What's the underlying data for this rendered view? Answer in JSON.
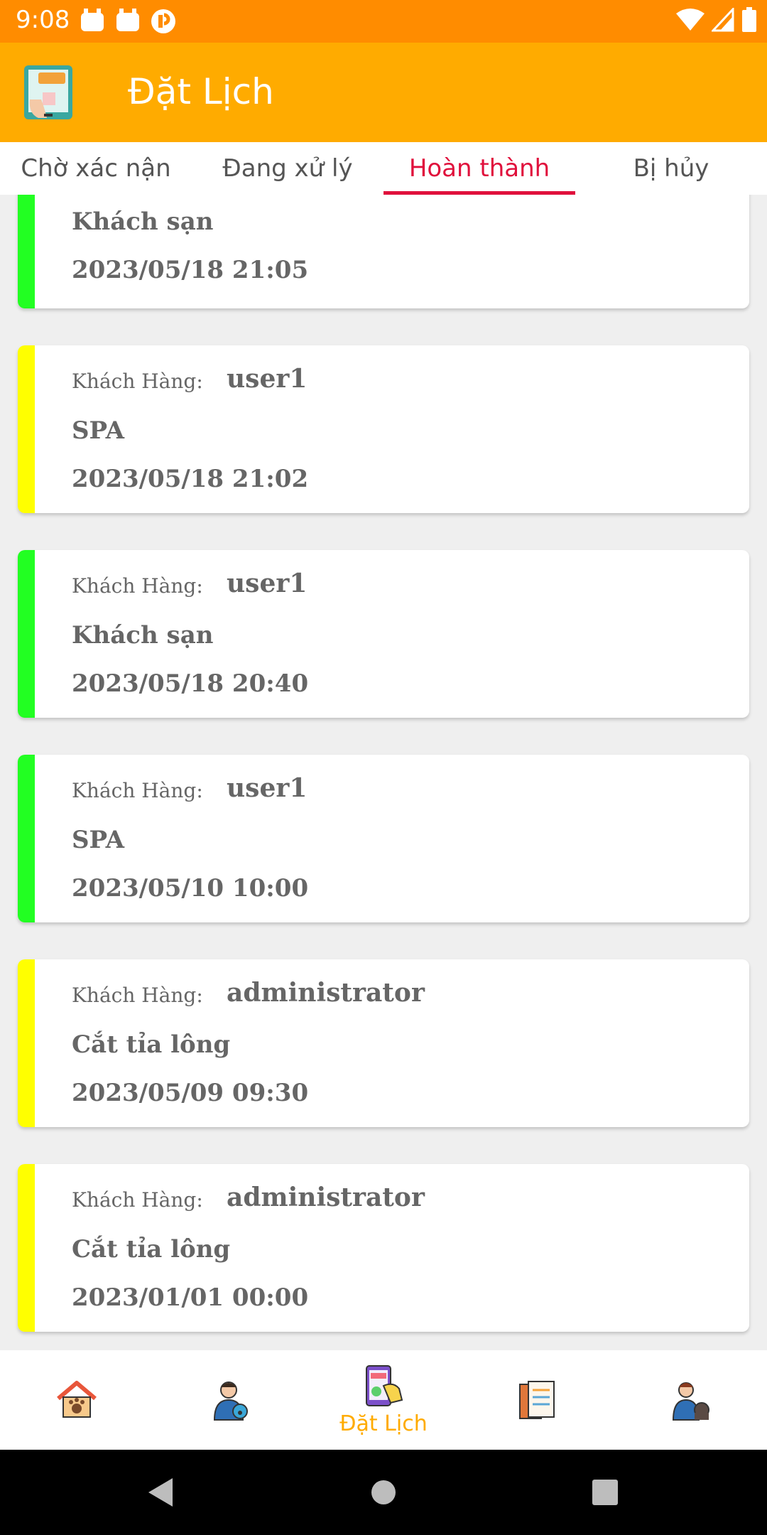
{
  "status_bar": {
    "time": "9:08"
  },
  "app_bar": {
    "title": "Đặt Lịch"
  },
  "tabs": [
    {
      "label": "Chờ xác nận"
    },
    {
      "label": "Đang xử lý"
    },
    {
      "label": "Hoàn thành",
      "active": true
    },
    {
      "label": "Bị hủy"
    }
  ],
  "bookings": [
    {
      "customer_label": "",
      "customer": "",
      "service": "Khách sạn",
      "datetime": "2023/05/18 21:05",
      "status_color": "#22ff22"
    },
    {
      "customer_label": "Khách Hàng:",
      "customer": "user1",
      "service": "SPA",
      "datetime": "2023/05/18 21:02",
      "status_color": "#ffff00"
    },
    {
      "customer_label": "Khách Hàng:",
      "customer": "user1",
      "service": "Khách sạn",
      "datetime": "2023/05/18 20:40",
      "status_color": "#22ff22"
    },
    {
      "customer_label": "Khách Hàng:",
      "customer": "user1",
      "service": "SPA",
      "datetime": "2023/05/10 10:00",
      "status_color": "#22ff22"
    },
    {
      "customer_label": "Khách Hàng:",
      "customer": "administrator",
      "service": "Cắt tỉa lông",
      "datetime": "2023/05/09 09:30",
      "status_color": "#ffff00"
    },
    {
      "customer_label": "Khách Hàng:",
      "customer": "administrator",
      "service": "Cắt tỉa lông",
      "datetime": "2023/01/01 00:00",
      "status_color": "#ffff00"
    }
  ],
  "bottom_nav": {
    "items": [
      {
        "icon": "pet-house-icon"
      },
      {
        "icon": "veterinarian-icon"
      },
      {
        "icon": "booking-icon",
        "label": "Đặt Lịch",
        "active": true
      },
      {
        "icon": "clipboard-icon"
      },
      {
        "icon": "pet-owner-icon"
      }
    ]
  },
  "colors": {
    "status_bar": "#ff8c00",
    "app_bar": "#ffab00",
    "tab_active": "#e0103c",
    "nav_active": "#ffab00"
  }
}
